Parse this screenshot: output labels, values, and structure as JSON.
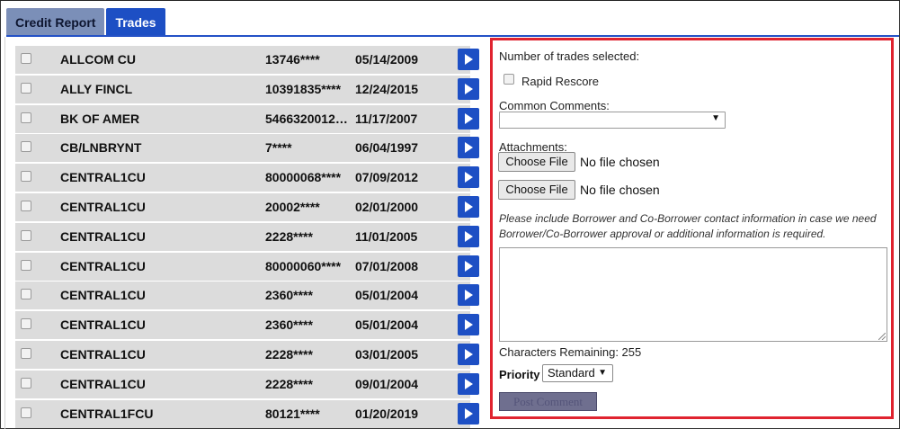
{
  "tabs": [
    {
      "label": "Credit Report",
      "active": false
    },
    {
      "label": "Trades",
      "active": true
    }
  ],
  "trades": [
    {
      "name": "ALLCOM CU",
      "account": "13746****",
      "date": "05/14/2009"
    },
    {
      "name": "ALLY FINCL",
      "account": "10391835****",
      "date": "12/24/2015"
    },
    {
      "name": "BK OF AMER",
      "account": "54663200125...",
      "date": "11/17/2007"
    },
    {
      "name": "CB/LNBRYNT",
      "account": "7****",
      "date": "06/04/1997"
    },
    {
      "name": "CENTRAL1CU",
      "account": "80000068****",
      "date": "07/09/2012"
    },
    {
      "name": "CENTRAL1CU",
      "account": "20002****",
      "date": "02/01/2000"
    },
    {
      "name": "CENTRAL1CU",
      "account": "2228****",
      "date": "11/01/2005"
    },
    {
      "name": "CENTRAL1CU",
      "account": "80000060****",
      "date": "07/01/2008"
    },
    {
      "name": "CENTRAL1CU",
      "account": "2360****",
      "date": "05/01/2004"
    },
    {
      "name": "CENTRAL1CU",
      "account": "2360****",
      "date": "05/01/2004"
    },
    {
      "name": "CENTRAL1CU",
      "account": "2228****",
      "date": "03/01/2005"
    },
    {
      "name": "CENTRAL1CU",
      "account": "2228****",
      "date": "09/01/2004"
    },
    {
      "name": "CENTRAL1FCU",
      "account": "80121****",
      "date": "01/20/2019"
    }
  ],
  "panel": {
    "trades_selected_label": "Number of trades selected:",
    "rapid_rescore_label": "Rapid Rescore",
    "common_comments_label": "Common Comments:",
    "common_comments_value": "",
    "attachments_label": "Attachments:",
    "choose_file_label": "Choose File",
    "no_file_text": "No file chosen",
    "note": "Please include Borrower and Co-Borrower contact information in case we need Borrower/Co-Borrower approval or additional information is required.",
    "characters_remaining": "Characters Remaining: 255",
    "priority_label": "Priority",
    "priority_value": "Standard",
    "post_comment_label": "Post Comment"
  },
  "colors": {
    "tab_active": "#1d4fc4",
    "tab_inactive": "#7b8fb8",
    "panel_border": "#e0232f",
    "row_background": "#dcdcdc",
    "go_button": "#1d4fc4"
  },
  "icons": {
    "row_action": "play-right-icon",
    "select_caret": "caret-down-icon"
  }
}
